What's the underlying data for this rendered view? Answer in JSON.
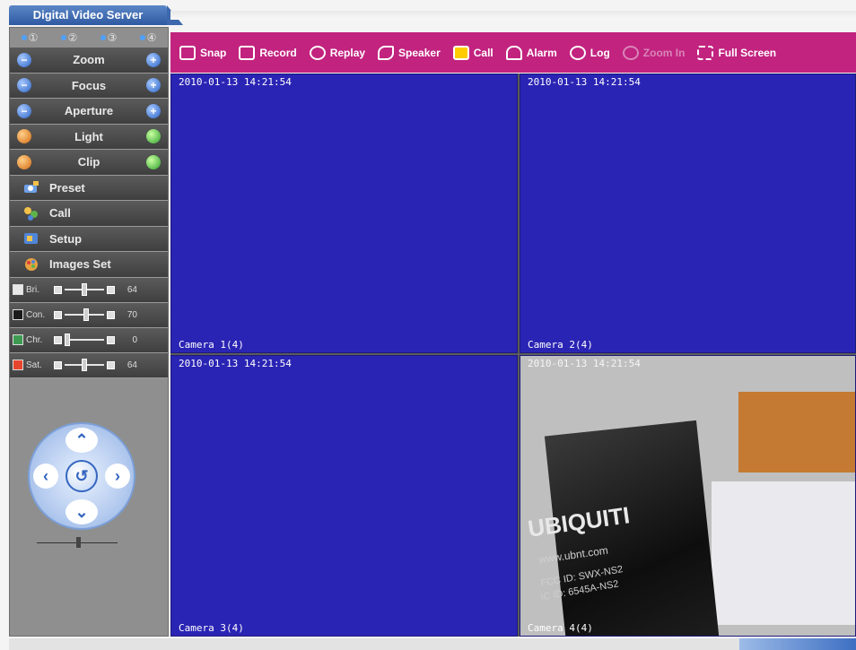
{
  "app": {
    "title": "Digital Video Server"
  },
  "sidebar": {
    "channels": [
      "①",
      "②",
      "③",
      "④"
    ],
    "controls": [
      {
        "label": "Zoom",
        "left": "minus",
        "right": "plus"
      },
      {
        "label": "Focus",
        "left": "minus",
        "right": "plus"
      },
      {
        "label": "Aperture",
        "left": "minus",
        "right": "plus"
      },
      {
        "label": "Light",
        "left": "off",
        "right": "on"
      },
      {
        "label": "Clip",
        "left": "off",
        "right": "on"
      }
    ],
    "menu": [
      {
        "label": "Preset",
        "icon": "preset-icon"
      },
      {
        "label": "Call",
        "icon": "call-icon"
      },
      {
        "label": "Setup",
        "icon": "setup-icon"
      },
      {
        "label": "Images Set",
        "icon": "images-set-icon"
      }
    ],
    "adjust": [
      {
        "name": "Bri.",
        "value": "64",
        "level": 0.5,
        "color": "#e8e8e8"
      },
      {
        "name": "Con.",
        "value": "70",
        "level": 0.55,
        "color": "#1b1b1b"
      },
      {
        "name": "Chr.",
        "value": "0",
        "level": 0.0,
        "color": "#3f9b52"
      },
      {
        "name": "Sat.",
        "value": "64",
        "level": 0.5,
        "color": "#e8452f"
      }
    ]
  },
  "toolbar": {
    "items": [
      {
        "label": "Snap",
        "icon": "camera-icon",
        "enabled": true
      },
      {
        "label": "Record",
        "icon": "record-icon",
        "enabled": true
      },
      {
        "label": "Replay",
        "icon": "replay-icon",
        "enabled": true
      },
      {
        "label": "Speaker",
        "icon": "speaker-icon",
        "enabled": true
      },
      {
        "label": "Call",
        "icon": "call-icon",
        "enabled": true
      },
      {
        "label": "Alarm",
        "icon": "alarm-icon",
        "enabled": true
      },
      {
        "label": "Log",
        "icon": "log-icon",
        "enabled": true
      },
      {
        "label": "Zoom In",
        "icon": "zoom-in-icon",
        "enabled": false
      },
      {
        "label": "Full Screen",
        "icon": "full-screen-icon",
        "enabled": true
      }
    ]
  },
  "cameras": [
    {
      "timestamp": "2010-01-13 14:21:54",
      "label": "Camera 1(4)"
    },
    {
      "timestamp": "2010-01-13 14:21:54",
      "label": "Camera 2(4)"
    },
    {
      "timestamp": "2010-01-13 14:21:54",
      "label": "Camera 3(4)"
    },
    {
      "timestamp": "2010-01-13 14:21:54",
      "label": "Camera 4(4)"
    }
  ],
  "live_feed": {
    "brand": "UBIQUITI",
    "site": "www.ubnt.com",
    "fcc": "FCC ID: SWX-NS2",
    "ic": "IC ID: 6545A-NS2"
  },
  "colors": {
    "toolbar": "#c2237f",
    "tile": "#2a24b4",
    "accent": "#2f5aa2"
  }
}
